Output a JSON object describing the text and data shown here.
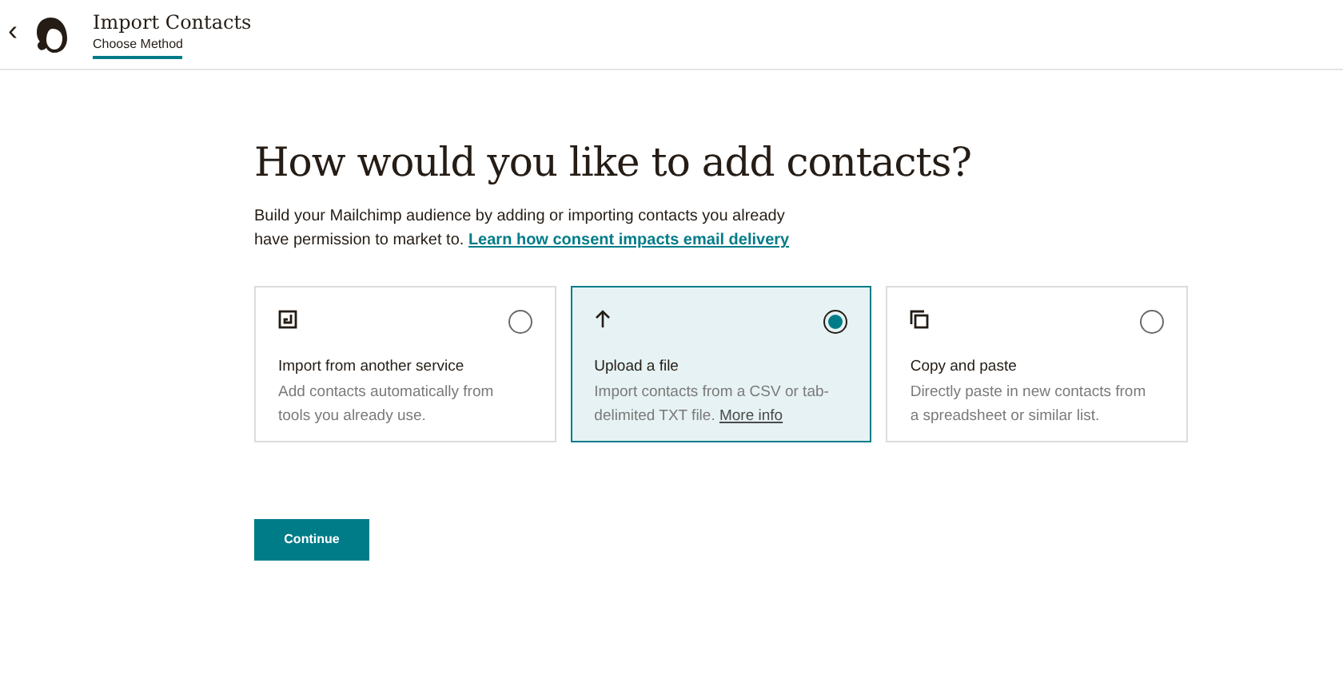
{
  "header": {
    "back": "‹",
    "title": "Import Contacts",
    "step": "Choose Method"
  },
  "heading": "How would you like to add contacts?",
  "intro": {
    "text": "Build your Mailchimp audience by adding or importing contacts you already have permission to market to.",
    "link": "Learn how consent impacts email delivery"
  },
  "options": [
    {
      "kind": "service",
      "title": "Import from another service",
      "description": "Add contacts automatically from tools you already use.",
      "selected": false
    },
    {
      "kind": "upload",
      "title": "Upload a file",
      "description": "Import contacts from a CSV or tab-delimited TXT file.",
      "link": "More info",
      "selected": true
    },
    {
      "kind": "copy",
      "title": "Copy and paste",
      "description": "Directly paste in new contacts from a spreadsheet or similar list.",
      "selected": false
    }
  ],
  "button": "Continue"
}
